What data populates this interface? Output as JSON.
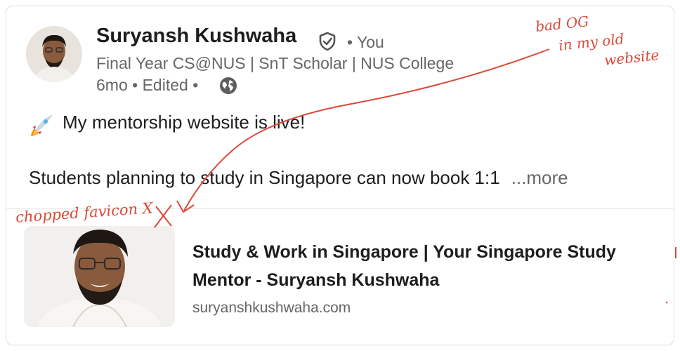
{
  "post": {
    "author_name": "Suryansh Kushwaha",
    "you_label": "• You",
    "headline": "Final Year CS@NUS | SnT Scholar | NUS College",
    "time": "6mo",
    "edited": "• Edited •",
    "body_line1": "My mentorship website is live!",
    "body_line2": "Students planning to study in Singapore can now book 1:1",
    "more_label": "...more"
  },
  "link_preview": {
    "title": "Study & Work in Singapore | Your Singapore Study Mentor - Suryansh Kushwaha",
    "domain": "suryanshkushwaha.com"
  },
  "annotations": {
    "og_line1": "bad OG",
    "og_line2": "in my old",
    "og_line3": "website",
    "favicon": "chopped favicon X"
  },
  "colors": {
    "annotation_red": "#d94a3a",
    "text_primary": "#1d1d1d",
    "text_secondary": "#666666"
  },
  "icons": {
    "verified": "shield-check-icon",
    "visibility": "globe-icon",
    "emoji": "rocket-icon"
  }
}
